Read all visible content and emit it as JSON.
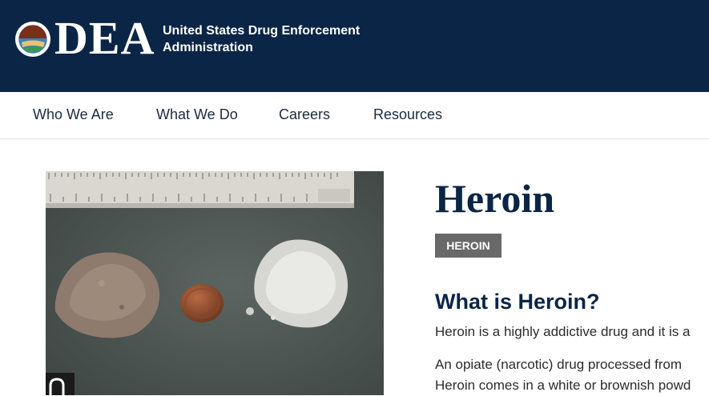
{
  "header": {
    "logo": "DEA",
    "agency_line1": "United States Drug Enforcement",
    "agency_line2": "Administration"
  },
  "nav": {
    "items": [
      "Who We Are",
      "What We Do",
      "Careers",
      "Resources"
    ]
  },
  "main": {
    "title": "Heroin",
    "tag": "HEROIN",
    "subtitle": "What is Heroin?",
    "paragraph1": "Heroin is a highly addictive drug and it is a",
    "paragraph2_line1": "An opiate (narcotic) drug processed from",
    "paragraph2_line2": "Heroin comes in a white or brownish powd"
  },
  "colors": {
    "header_bg": "#0b2546",
    "title": "#0b2546",
    "tag_bg": "#696969"
  }
}
